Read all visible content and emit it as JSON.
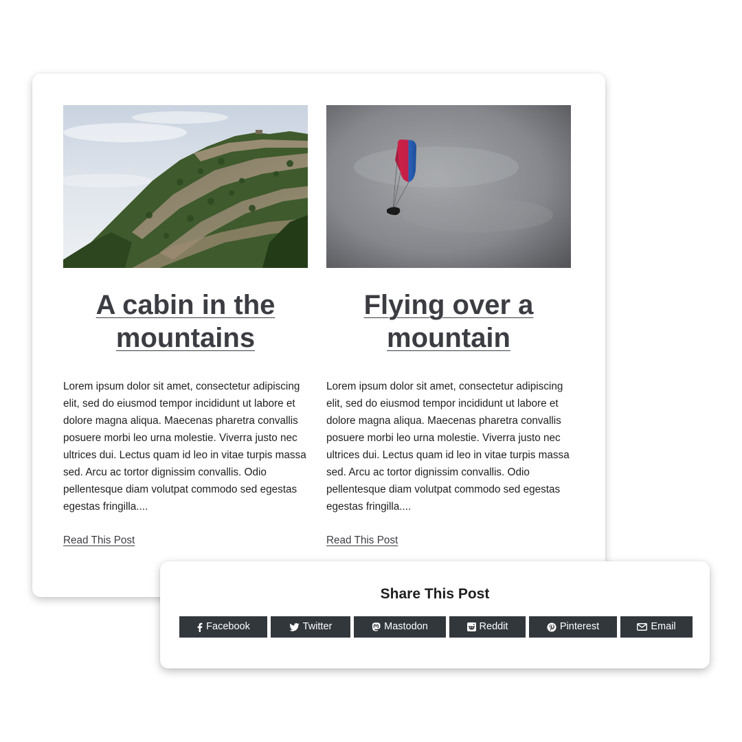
{
  "posts": [
    {
      "title": "A cabin in the mountains",
      "excerpt": "Lorem ipsum dolor sit amet, consectetur adipiscing elit, sed do eiusmod tempor incididunt ut labore et dolore magna aliqua. Maecenas pharetra convallis posuere morbi leo urna molestie. Viverra justo nec ultrices dui. Lectus quam id leo in vitae turpis massa sed. Arcu ac tortor dignissim convallis. Odio pellentesque diam volutpat commodo sed egestas egestas fringilla....",
      "link_label": "Read This Post",
      "image_subject": "mountain-cliff-photo"
    },
    {
      "title": "Flying over a mountain",
      "excerpt": "Lorem ipsum dolor sit amet, consectetur adipiscing elit, sed do eiusmod tempor incididunt ut labore et dolore magna aliqua. Maecenas pharetra convallis posuere morbi leo urna molestie. Viverra justo nec ultrices dui. Lectus quam id leo in vitae turpis massa sed. Arcu ac tortor dignissim convallis. Odio pellentesque diam volutpat commodo sed egestas egestas fringilla....",
      "link_label": "Read This Post",
      "image_subject": "paraglider-sky-photo"
    }
  ],
  "share": {
    "title": "Share This Post",
    "buttons": [
      {
        "label": "Facebook",
        "icon": "facebook-icon"
      },
      {
        "label": "Twitter",
        "icon": "twitter-icon"
      },
      {
        "label": "Mastodon",
        "icon": "mastodon-icon"
      },
      {
        "label": "Reddit",
        "icon": "reddit-icon"
      },
      {
        "label": "Pinterest",
        "icon": "pinterest-icon"
      },
      {
        "label": "Email",
        "icon": "email-icon"
      }
    ]
  },
  "colors": {
    "button_bg": "#32373c",
    "title_text": "#3b3d42",
    "body_text": "#1e1e1e"
  }
}
